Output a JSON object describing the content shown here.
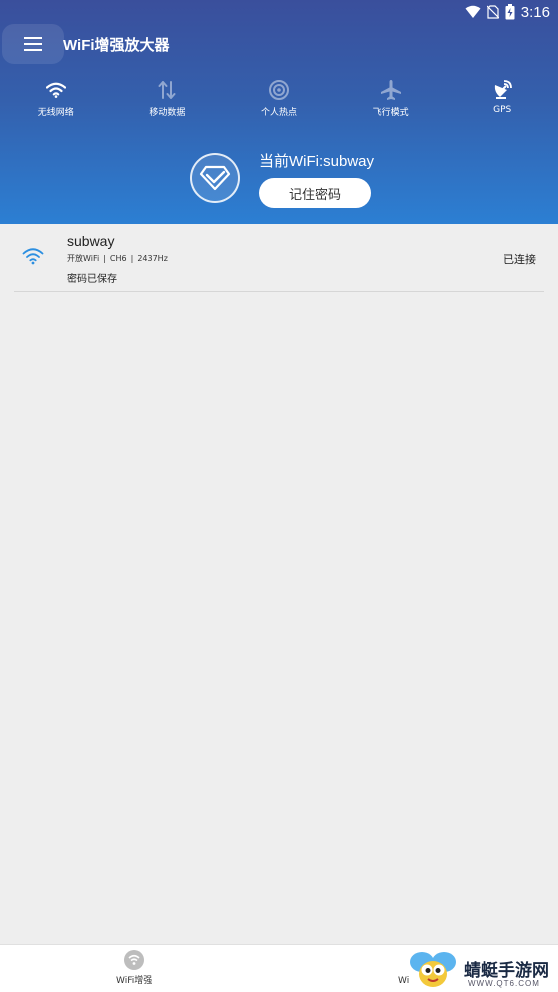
{
  "status_bar": {
    "time": "3:16"
  },
  "app": {
    "title": "WiFi增强放大器"
  },
  "quick_toggles": [
    {
      "label": "无线网络",
      "icon": "wifi-icon",
      "active": true
    },
    {
      "label": "移动数据",
      "icon": "mobile-data-icon",
      "active": false
    },
    {
      "label": "个人热点",
      "icon": "hotspot-icon",
      "active": false
    },
    {
      "label": "飞行模式",
      "icon": "airplane-icon",
      "active": false
    },
    {
      "label": "GPS",
      "icon": "gps-icon",
      "active": true
    }
  ],
  "current": {
    "label": "当前WiFi:subway",
    "remember_button": "记住密码"
  },
  "networks": [
    {
      "ssid": "subway",
      "security": "开放WiFi",
      "channel": "CH6",
      "frequency": "2437Hz",
      "saved": "密码已保存",
      "status": "已连接"
    }
  ],
  "bottom_nav": {
    "items": [
      {
        "label": "WiFi增强",
        "icon": "wifi-boost-icon"
      },
      {
        "label": "Wi",
        "icon": "wifi-icon"
      }
    ]
  },
  "watermark": {
    "text": "蜻蜓手游网",
    "url": "WWW.QT6.COM"
  },
  "colors": {
    "header_top": "#3a4f9c",
    "header_bottom": "#2c7fd3",
    "background": "#eeeeee",
    "wifi_signal": "#2c8fe0"
  }
}
